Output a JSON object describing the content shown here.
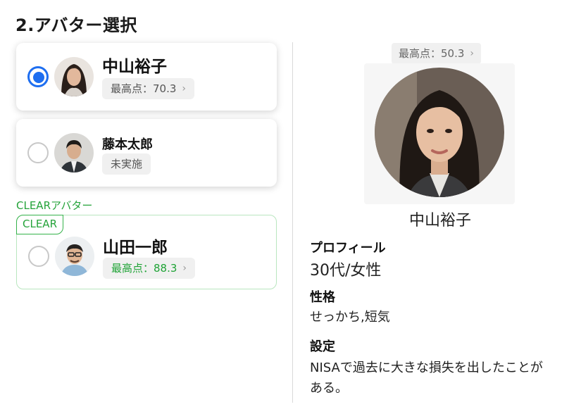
{
  "section_title": "2.アバター選択",
  "avatars": [
    {
      "name": "中山裕子",
      "status": "最高点：70.3",
      "selected": true
    },
    {
      "name": "藤本太郎",
      "status": "未実施",
      "selected": false
    }
  ],
  "clear_section": {
    "heading": "CLEARアバター",
    "tag": "CLEAR",
    "avatar": {
      "name": "山田一郎",
      "status": "最高点：88.3",
      "selected": false
    }
  },
  "detail": {
    "high_score": "最高点：50.3",
    "name": "中山裕子",
    "profile_label": "プロフィール",
    "profile_value": "30代/女性",
    "personality_label": "性格",
    "personality_value": "せっかち,短気",
    "setting_label": "設定",
    "setting_value_line1": "NISAで過去に大きな損失を出したことが",
    "setting_value_line2": "ある。"
  },
  "colors": {
    "accent_blue": "#1e6ef0",
    "clear_green": "#25a33a"
  },
  "icons": {
    "chevron": "chevron-right-icon",
    "radio": "radio-button"
  }
}
